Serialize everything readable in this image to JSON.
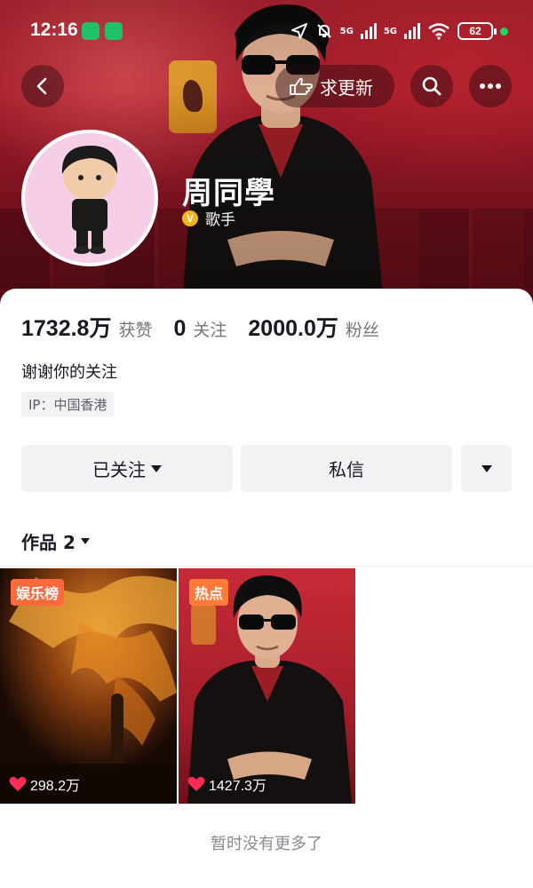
{
  "status_bar": {
    "time": "12:16",
    "network_1": "5G",
    "network_2": "5G",
    "battery": "62"
  },
  "header": {
    "request_update_label": "求更新",
    "display_name": "周同學",
    "verified_badge": "V",
    "role": "歌手"
  },
  "stats": [
    {
      "value": "1732.8万",
      "label": "获赞"
    },
    {
      "value": "0",
      "label": "关注"
    },
    {
      "value": "2000.0万",
      "label": "粉丝"
    }
  ],
  "bio": "谢谢你的关注",
  "ip_location": "IP：中国香港",
  "actions": {
    "follow_label": "已关注",
    "message_label": "私信"
  },
  "works": {
    "label": "作品 2",
    "items": [
      {
        "badge": "娱乐榜",
        "likes": "298.2万"
      },
      {
        "badge": "热点",
        "likes": "1427.3万"
      }
    ]
  },
  "footer_text": "暂时没有更多了",
  "colors": {
    "banner_red": "#b52332",
    "badge_orange": "#ff6a3d",
    "verified_gold": "#f3b51d",
    "heart_red": "#fe2c55"
  }
}
